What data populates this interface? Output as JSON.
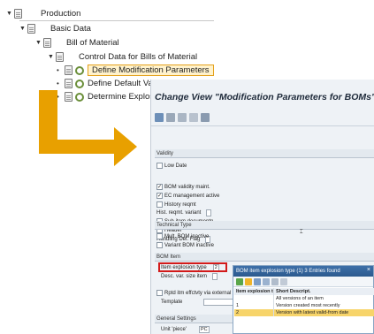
{
  "tree": {
    "items": [
      {
        "label": "Production"
      },
      {
        "label": "Basic Data"
      },
      {
        "label": "Bill of Material"
      },
      {
        "label": "Control Data for Bills of Material"
      },
      {
        "label": "Define Modification Parameters"
      },
      {
        "label": "Define Default Values"
      },
      {
        "label": "Determine Explosion Mode"
      }
    ]
  },
  "window": {
    "title": "Change View \"Modification Parameters for BOMs\": Details",
    "validity": {
      "header": "Validity",
      "low_date": "Low Date",
      "bom_validity": "BOM validity maint.",
      "ec_mgmt": "EC management active",
      "history": "History reqmt",
      "hist_variant": "Hist. reqmt. variant",
      "sub_item": "Sub-item documentn",
      "header_field": "Header",
      "handling": "Handling Del. Flag"
    },
    "technical": {
      "header": "Technical Type",
      "mult_bom": "Mult. BOM inactive",
      "variant_bom": "Variant BOM inactive"
    },
    "bom_item": {
      "header": "BOM Item",
      "explosion_type": "Item explosion type",
      "explosion_value": "2",
      "desc_var": "Desc. var. size item",
      "rptd": "Rptd itm effctvty via external fie",
      "template": "Template"
    },
    "general": {
      "header": "General Settings",
      "unit_label": "Unit 'piece'",
      "unit_value": "PC"
    }
  },
  "popup": {
    "title": "BOM item explosion type (1)   3 Entries found",
    "close": "×",
    "columns": [
      "Item explosion type",
      "Short Descript."
    ],
    "rows": [
      {
        "code": "",
        "desc": "All versions of an item"
      },
      {
        "code": "1",
        "desc": "Version created most recently"
      },
      {
        "code": "2",
        "desc": "Version with latest valid-from date"
      }
    ]
  }
}
